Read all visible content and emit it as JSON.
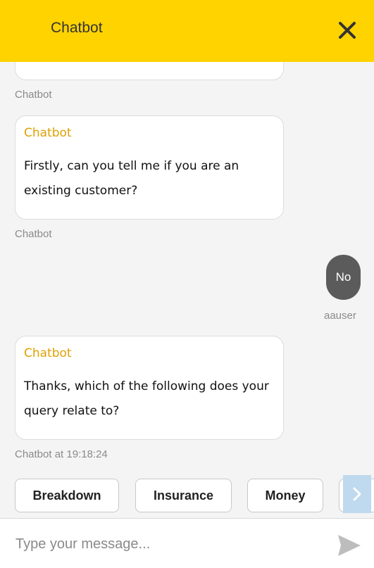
{
  "header": {
    "title": "Chatbot",
    "background": "#ffd300"
  },
  "messages": [
    {
      "meta": "Chatbot"
    },
    {
      "sender": "Chatbot",
      "text": "Firstly, can you tell me if you are an existing customer?",
      "meta": "Chatbot"
    },
    {
      "text": "No",
      "meta": "aauser"
    },
    {
      "sender": "Chatbot",
      "text": "Thanks, which of the following does your query relate to?",
      "meta": "Chatbot at 19:18:24"
    }
  ],
  "quick_replies": [
    "Breakdown",
    "Insurance",
    "Money"
  ],
  "input": {
    "placeholder": "Type your message..."
  },
  "colors": {
    "accent": "#ffd300",
    "sender_name": "#e0a100",
    "user_bubble": "#5b5b5b"
  },
  "icons": {
    "close": "close-icon",
    "send": "send-icon",
    "scroll": "chevron-right-icon"
  }
}
